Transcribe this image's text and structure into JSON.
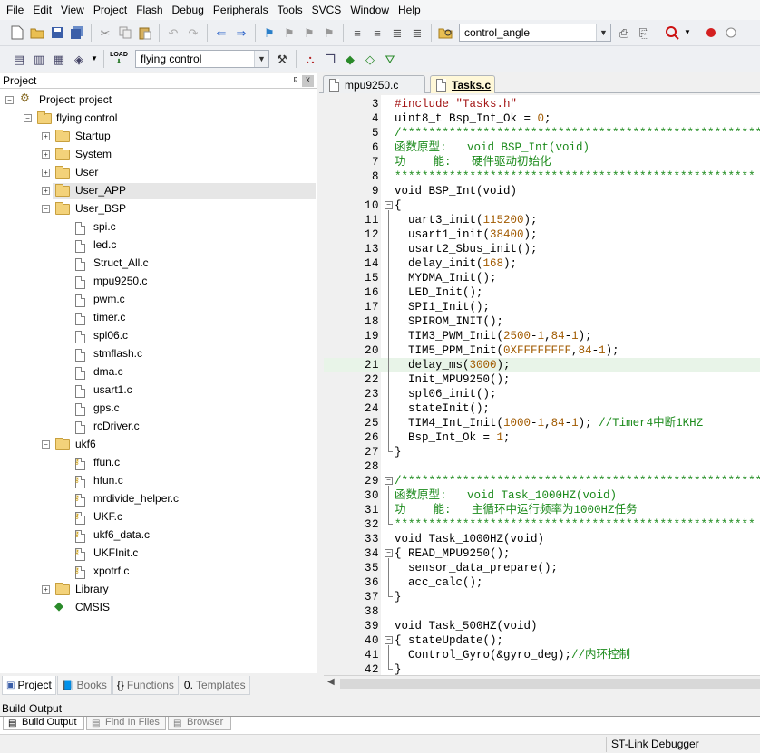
{
  "menu": [
    "File",
    "Edit",
    "View",
    "Project",
    "Flash",
    "Debug",
    "Peripherals",
    "Tools",
    "SVCS",
    "Window",
    "Help"
  ],
  "toolbar1": {
    "find_combo": "control_angle"
  },
  "toolbar2": {
    "load_label": "LOAD",
    "target_combo": "flying control"
  },
  "project_panel": {
    "title": "Project",
    "pin": " #",
    "close": "x"
  },
  "tree": {
    "root": "Project: project",
    "target": "flying control",
    "groups": [
      "Startup",
      "System",
      "User",
      "User_APP",
      "User_BSP",
      "ukf6",
      "Library",
      "CMSIS"
    ],
    "bsp_files": [
      "spi.c",
      "led.c",
      "Struct_All.c",
      "mpu9250.c",
      "pwm.c",
      "timer.c",
      "spl06.c",
      "stmflash.c",
      "dma.c",
      "usart1.c",
      "gps.c",
      "rcDriver.c"
    ],
    "ukf_files": [
      "ffun.c",
      "hfun.c",
      "mrdivide_helper.c",
      "UKF.c",
      "ukf6_data.c",
      "UKFInit.c",
      "xpotrf.c"
    ]
  },
  "left_tabs": [
    "Project",
    "Books",
    "Functions",
    "Templates"
  ],
  "editor_tabs": [
    "mpu9250.c",
    "Tasks.c"
  ],
  "code": {
    "lines": [
      {
        "n": "3",
        "t": "#include \"Tasks.h\""
      },
      {
        "n": "4",
        "t": "uint8_t Bsp_Int_Ok = 0;"
      },
      {
        "n": "5",
        "t": "/*****************************************************"
      },
      {
        "n": "6",
        "t": "函数原型:   void BSP_Int(void)"
      },
      {
        "n": "7",
        "t": "功    能:   硬件驱动初始化"
      },
      {
        "n": "8",
        "t": "*****************************************************"
      },
      {
        "n": "9",
        "t": "void BSP_Int(void)"
      },
      {
        "n": "10",
        "t": "{"
      },
      {
        "n": "11",
        "t": "  uart3_init(115200);"
      },
      {
        "n": "12",
        "t": "  usart1_init(38400);"
      },
      {
        "n": "13",
        "t": "  usart2_Sbus_init();"
      },
      {
        "n": "14",
        "t": "  delay_init(168);"
      },
      {
        "n": "15",
        "t": "  MYDMA_Init();"
      },
      {
        "n": "16",
        "t": "  LED_Init();"
      },
      {
        "n": "17",
        "t": "  SPI1_Init();"
      },
      {
        "n": "18",
        "t": "  SPIROM_INIT();"
      },
      {
        "n": "19",
        "t": "  TIM3_PWM_Init(2500-1,84-1);"
      },
      {
        "n": "20",
        "t": "  TIM5_PPM_Init(0XFFFFFFFF,84-1);"
      },
      {
        "n": "21",
        "t": "  delay_ms(3000);"
      },
      {
        "n": "22",
        "t": "  Init_MPU9250();"
      },
      {
        "n": "23",
        "t": "  spl06_init();"
      },
      {
        "n": "24",
        "t": "  stateInit();"
      },
      {
        "n": "25",
        "t": "  TIM4_Int_Init(1000-1,84-1); //Timer4中断1KHZ"
      },
      {
        "n": "26",
        "t": "  Bsp_Int_Ok = 1;"
      },
      {
        "n": "27",
        "t": "}"
      },
      {
        "n": "28",
        "t": ""
      },
      {
        "n": "29",
        "t": "/*****************************************************"
      },
      {
        "n": "30",
        "t": "函数原型:   void Task_1000HZ(void)"
      },
      {
        "n": "31",
        "t": "功    能:   主循环中运行频率为1000HZ任务"
      },
      {
        "n": "32",
        "t": "*****************************************************"
      },
      {
        "n": "33",
        "t": "void Task_1000HZ(void)"
      },
      {
        "n": "34",
        "t": "{ READ_MPU9250();"
      },
      {
        "n": "35",
        "t": "  sensor_data_prepare();"
      },
      {
        "n": "36",
        "t": "  acc_calc();"
      },
      {
        "n": "37",
        "t": "}"
      },
      {
        "n": "38",
        "t": ""
      },
      {
        "n": "39",
        "t": "void Task_500HZ(void)"
      },
      {
        "n": "40",
        "t": "{ stateUpdate();"
      },
      {
        "n": "41",
        "t": "  Control_Gyro(&gyro_deg);//内环控制"
      },
      {
        "n": "42",
        "t": "}"
      }
    ],
    "current_line": "21"
  },
  "build_output": {
    "title": "Build Output",
    "tabs": [
      "Build Output",
      "Find In Files",
      "Browser"
    ]
  },
  "status": {
    "debugger": "ST-Link Debugger"
  },
  "colors": {
    "comment": "#1b8a1b",
    "number": "#a15a00",
    "string": "#a31515",
    "active_tab": "#fff8d8",
    "current_line": "#e8f4e8"
  }
}
